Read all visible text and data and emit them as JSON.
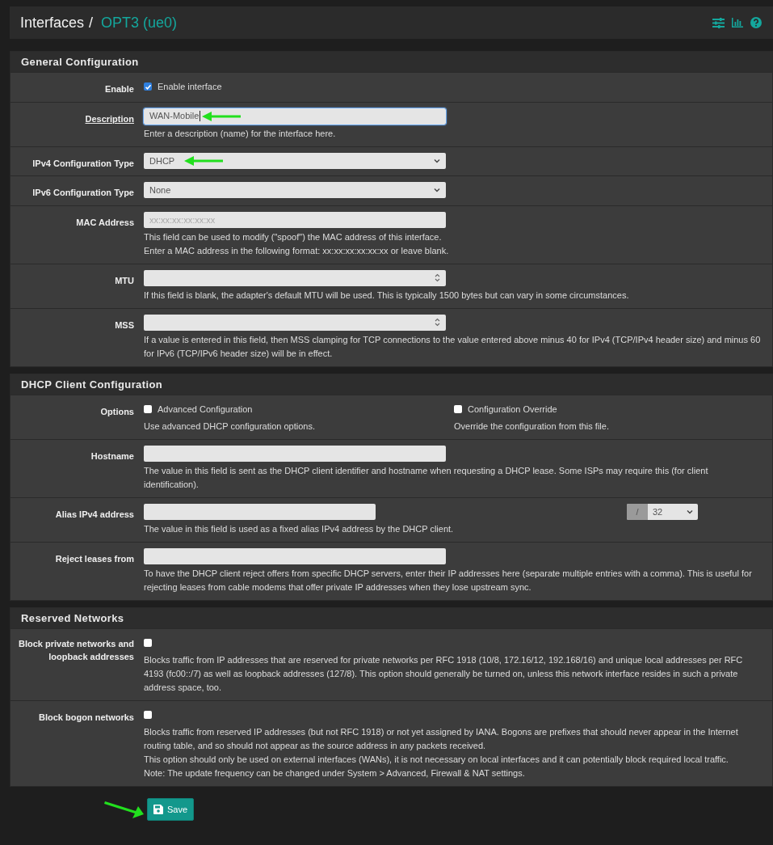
{
  "breadcrumb": {
    "parent": "Interfaces",
    "separator": "/",
    "current": "OPT3 (ue0)"
  },
  "sections": [
    {
      "title": "General Configuration",
      "rows": [
        {
          "kind": "checkbox",
          "label": "Enable",
          "checked": true,
          "text": "Enable interface"
        },
        {
          "kind": "text",
          "label": "Description",
          "link": true,
          "value": "WAN-Mobile",
          "focused": true,
          "marked": true,
          "help": [
            "Enter a description (name) for the interface here."
          ]
        },
        {
          "kind": "select",
          "label": "IPv4 Configuration Type",
          "value": "DHCP",
          "marked": true
        },
        {
          "kind": "select",
          "label": "IPv6 Configuration Type",
          "value": "None",
          "marked": false
        },
        {
          "kind": "text",
          "label": "MAC Address",
          "placeholder": "xx:xx:xx:xx:xx:xx",
          "help": [
            "This field can be used to modify (\"spoof\") the MAC address of this interface.",
            "Enter a MAC address in the following format: xx:xx:xx:xx:xx:xx or leave blank."
          ]
        },
        {
          "kind": "number",
          "label": "MTU",
          "help": [
            "If this field is blank, the adapter's default MTU will be used. This is typically 1500 bytes but can vary in some circumstances."
          ]
        },
        {
          "kind": "number",
          "label": "MSS",
          "help": [
            "If a value is entered in this field, then MSS clamping for TCP connections to the value entered above minus 40 for IPv4 (TCP/IPv4 header size) and minus 60 for IPv6 (TCP/IPv6 header size) will be in effect."
          ]
        }
      ]
    },
    {
      "title": "DHCP Client Configuration",
      "rows": [
        {
          "kind": "options",
          "label": "Options",
          "options": [
            {
              "checked": false,
              "text": "Advanced Configuration",
              "help": "Use advanced DHCP configuration options."
            },
            {
              "checked": false,
              "text": "Configuration Override",
              "help": "Override the configuration from this file."
            }
          ]
        },
        {
          "kind": "text",
          "label": "Hostname",
          "help": [
            "The value in this field is sent as the DHCP client identifier and hostname when requesting a DHCP lease. Some ISPs may require this (for client identification)."
          ]
        },
        {
          "kind": "cidr",
          "label": "Alias IPv4 address",
          "separator": "/",
          "mask": "32",
          "help": [
            "The value in this field is used as a fixed alias IPv4 address by the DHCP client."
          ]
        },
        {
          "kind": "text",
          "label": "Reject leases from",
          "help": [
            "To have the DHCP client reject offers from specific DHCP servers, enter their IP addresses here (separate multiple entries with a comma). This is useful for rejecting leases from cable modems that offer private IP addresses when they lose upstream sync."
          ]
        }
      ]
    },
    {
      "title": "Reserved Networks",
      "rows": [
        {
          "kind": "checkbox",
          "label": "Block private networks and loopback addresses",
          "checked": false,
          "help": [
            "Blocks traffic from IP addresses that are reserved for private networks per RFC 1918 (10/8, 172.16/12, 192.168/16) and unique local addresses per RFC 4193 (fc00::/7) as well as loopback addresses (127/8). This option should generally be turned on, unless this network interface resides in such a private address space, too."
          ]
        },
        {
          "kind": "checkbox",
          "label": "Block bogon networks",
          "checked": false,
          "help": [
            "Blocks traffic from reserved IP addresses (but not RFC 1918) or not yet assigned by IANA. Bogons are prefixes that should never appear in the Internet routing table, and so should not appear as the source address in any packets received.",
            "This option should only be used on external interfaces (WANs), it is not necessary on local interfaces and it can potentially block required local traffic.",
            "Note: The update frequency can be changed under System > Advanced, Firewall & NAT settings."
          ]
        }
      ]
    }
  ],
  "save": {
    "label": "Save",
    "marked": true
  }
}
